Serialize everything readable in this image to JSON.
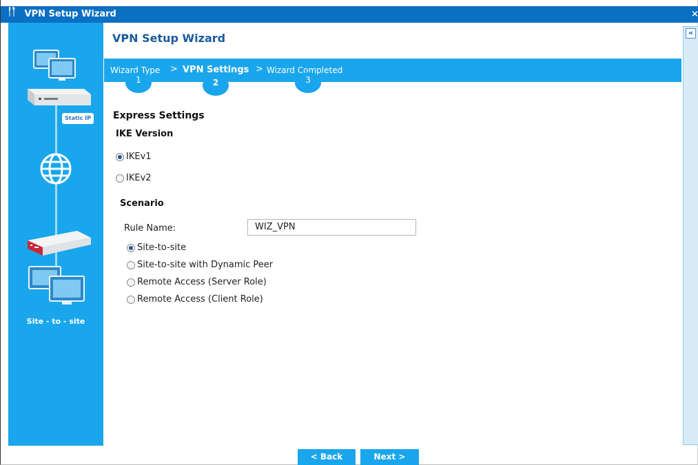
{
  "window": {
    "title": "VPN Setup Wizard",
    "title_icon": "tools-icon",
    "close_icon": "close-icon",
    "close_glyph": "⨯"
  },
  "sidebar": {
    "static_ip_label": "Static IP",
    "site_label": "Site - to - site",
    "icons": [
      "computers-icon",
      "router-icon",
      "globe-icon",
      "router-red-icon",
      "computers-icon"
    ]
  },
  "content": {
    "title": "VPN Setup Wizard"
  },
  "steps": [
    {
      "label": "Wizard Type",
      "number": "1",
      "active": false
    },
    {
      "label": "VPN Settings",
      "number": "2",
      "active": true
    },
    {
      "label": "Wizard Completed",
      "number": "3",
      "active": false
    }
  ],
  "step_separator": ">",
  "express_settings": {
    "heading": "Express Settings",
    "ike_heading": "IKE Version",
    "ike_options": [
      {
        "label": "IKEv1",
        "selected": true
      },
      {
        "label": "IKEv2",
        "selected": false
      }
    ],
    "scenario_heading": "Scenario",
    "rule_name_label": "Rule Name:",
    "rule_name_value": "WIZ_VPN",
    "scenario_options": [
      {
        "label": "Site-to-site",
        "selected": true
      },
      {
        "label": "Site-to-site with Dynamic Peer",
        "selected": false
      },
      {
        "label": "Remote Access (Server Role)",
        "selected": false
      },
      {
        "label": "Remote Access (Client Role)",
        "selected": false
      }
    ]
  },
  "right_rail": {
    "collapse_glyph": "«"
  },
  "buttons": {
    "back": "< Back",
    "next": "Next >"
  },
  "colors": {
    "titlebar": "#0b6fc2",
    "accent": "#1aa6ec",
    "heading": "#1a5b9e"
  }
}
